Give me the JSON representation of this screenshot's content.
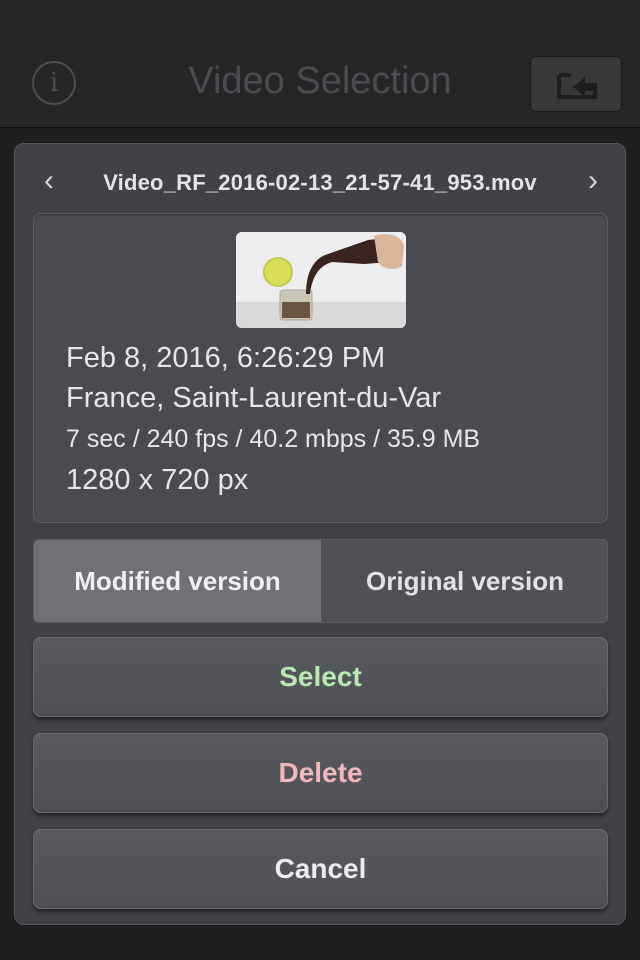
{
  "navbar": {
    "title": "Video Selection",
    "info_icon": "info-circle-icon",
    "info_glyph": "i",
    "export_icon": "export-tray-icon"
  },
  "video": {
    "filename": "Video_RF_2016-02-13_21-57-41_953.mov",
    "prev_glyph": "‹",
    "next_glyph": "›",
    "date": "Feb 8, 2016, 6:26:29 PM",
    "location": "France, Saint-Laurent-du-Var",
    "stats": "7 sec / 240 fps / 40.2 mbps / 35.9 MB",
    "resolution": "1280 x 720 px"
  },
  "version_toggle": {
    "options": [
      "Modified version",
      "Original version"
    ],
    "selected": "Modified version"
  },
  "actions": {
    "select_label": "Select",
    "delete_label": "Delete",
    "cancel_label": "Cancel"
  },
  "colors": {
    "select_text": "#b9e8b4",
    "delete_text": "#f0b8bc",
    "panel_bg": "#414246",
    "navbar_bg": "#262628"
  }
}
